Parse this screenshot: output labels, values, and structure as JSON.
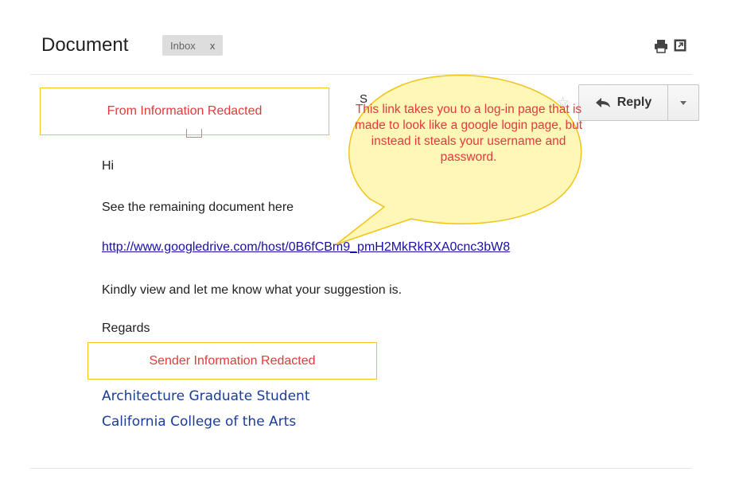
{
  "header": {
    "subject": "Document",
    "label": "Inbox",
    "label_remove": "x"
  },
  "icons": {
    "print": "print-icon",
    "popout": "new-window-icon",
    "star": "star-icon",
    "reply": "reply-arrow-icon",
    "more": "caret-down-icon"
  },
  "sender_row": {
    "redacted_from": "From Information Redacted",
    "partial_char": "S",
    "reply_label": "Reply"
  },
  "body": {
    "greeting": "Hi",
    "line1": "See the remaining document here",
    "link": "http://www.googledrive.com/host/0B6fCBm9_pmH2MkRkRXA0cnc3bW8",
    "line2": "Kindly view and let me know what your suggestion is.",
    "closing": "Regards",
    "redacted_sender": "Sender Information Redacted",
    "signature_line1": "Architecture Graduate Student",
    "signature_line2": "California College of the Arts"
  },
  "annotation": {
    "text": "This link takes you to a log-in page that is made to look like a google login page, but instead it steals your username and password."
  },
  "colors": {
    "annotation_text": "#e23a3a",
    "annotation_fill": "#fff7b8",
    "annotation_border": "#f0c419",
    "link": "#1a0dab",
    "signature": "#1a3d99"
  }
}
